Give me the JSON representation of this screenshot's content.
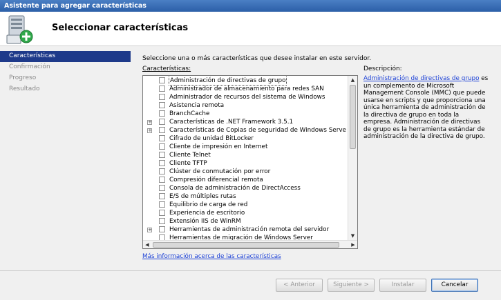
{
  "window": {
    "title": "Asistente para agregar características"
  },
  "header": {
    "title": "Seleccionar características",
    "icon": "server-add-icon"
  },
  "nav": {
    "items": [
      {
        "label": "Características",
        "active": true
      },
      {
        "label": "Confirmación",
        "active": false
      },
      {
        "label": "Progreso",
        "active": false
      },
      {
        "label": "Resultado",
        "active": false
      }
    ]
  },
  "main": {
    "instruction": "Seleccione una o más características que desee instalar en este servidor.",
    "features_label": "Características:",
    "features": [
      {
        "label": "Administración de directivas de grupo",
        "expandable": false,
        "selected": true
      },
      {
        "label": "Administrador de almacenamiento para redes SAN",
        "expandable": false
      },
      {
        "label": "Administrador de recursos del sistema de Windows",
        "expandable": false
      },
      {
        "label": "Asistencia remota",
        "expandable": false
      },
      {
        "label": "BranchCache",
        "expandable": false
      },
      {
        "label": "Características de .NET Framework 3.5.1",
        "expandable": true
      },
      {
        "label": "Características de Copias de seguridad de Windows Serve",
        "expandable": true
      },
      {
        "label": "Cifrado de unidad BitLocker",
        "expandable": false
      },
      {
        "label": "Cliente de impresión en Internet",
        "expandable": false
      },
      {
        "label": "Cliente Telnet",
        "expandable": false
      },
      {
        "label": "Cliente TFTP",
        "expandable": false
      },
      {
        "label": "Clúster de conmutación por error",
        "expandable": false
      },
      {
        "label": "Compresión diferencial remota",
        "expandable": false
      },
      {
        "label": "Consola de administración de DirectAccess",
        "expandable": false
      },
      {
        "label": "E/S de múltiples rutas",
        "expandable": false
      },
      {
        "label": "Equilibrio de carga de red",
        "expandable": false
      },
      {
        "label": "Experiencia de escritorio",
        "expandable": false
      },
      {
        "label": "Extensión IIS de WinRM",
        "expandable": false
      },
      {
        "label": "Herramientas de administración remota del servidor",
        "expandable": true
      },
      {
        "label": "Herramientas de migración de Windows Server",
        "expandable": false
      }
    ],
    "description_label": "Descripción:",
    "description_link": "Administración de directivas de grupo",
    "description_text": "es un complemento de Microsoft Management Console (MMC) que puede usarse en scripts y que proporciona una única herramienta de administración de la directiva de grupo en toda la empresa. Administración de directivas de grupo es la herramienta estándar de administración de la directiva de grupo.",
    "more_info": "Más información acerca de las características"
  },
  "footer": {
    "back": "< Anterior",
    "next": "Siguiente >",
    "install": "Instalar",
    "cancel": "Cancelar"
  }
}
